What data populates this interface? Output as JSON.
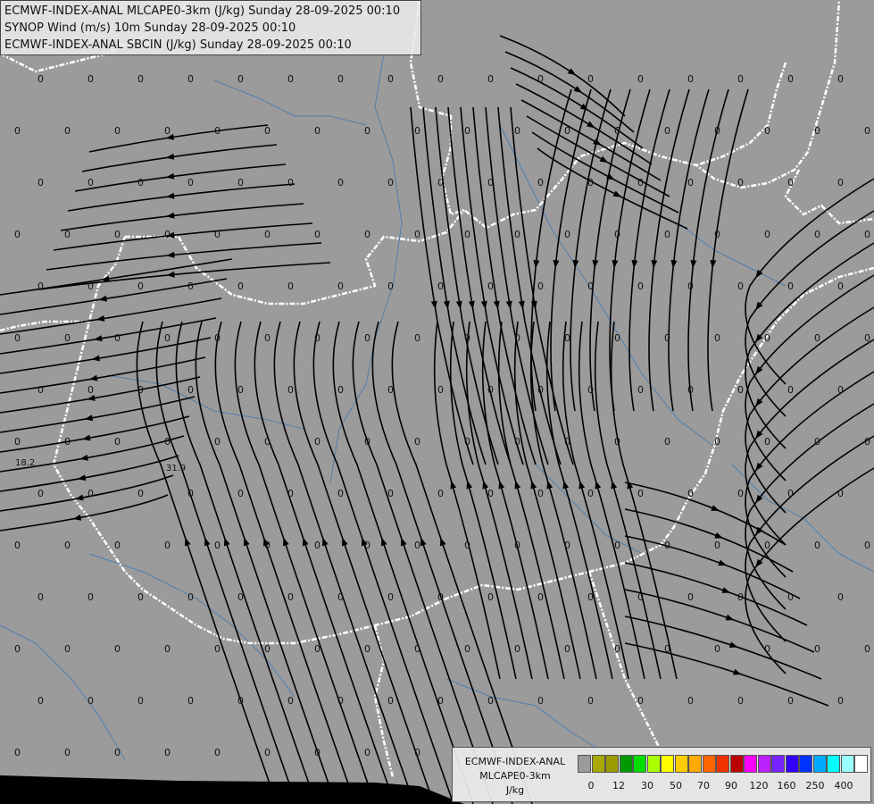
{
  "header": {
    "line1": "ECMWF-INDEX-ANAL MLCAPE0-3km (J/kg) Sunday 28-09-2025 00:10",
    "line2": "SYNOP Wind (m/s) 10m Sunday 28-09-2025 00:10",
    "line3": "ECMWF-INDEX-ANAL SBCIN (J/kg) Sunday 28-09-2025 00:10"
  },
  "legend": {
    "model": "ECMWF-INDEX-ANAL",
    "field": "MLCAPE0-3km",
    "unit": "J/kg",
    "colors": [
      "#9b9b9b",
      "#a8a800",
      "#9b9b00",
      "#009900",
      "#00dd00",
      "#aaff00",
      "#ffff00",
      "#ffcc00",
      "#ffaa00",
      "#ff6600",
      "#ee3300",
      "#bb0000",
      "#ff00ff",
      "#bb22ff",
      "#7722ff",
      "#3300ff",
      "#0033ff",
      "#00aaff",
      "#00ffff",
      "#99ffff",
      "#ffffff"
    ],
    "ticks": [
      "0",
      "12",
      "30",
      "50",
      "70",
      "90",
      "120",
      "160",
      "250",
      "400"
    ]
  },
  "labels": {
    "zero": "0",
    "station_a": "18.2",
    "station_b": "31.9"
  },
  "colors": {
    "background": "#9b9b9b",
    "border": "#ffffff",
    "river": "#4f7fae",
    "streamline": "#000000",
    "outside": "#000000"
  }
}
